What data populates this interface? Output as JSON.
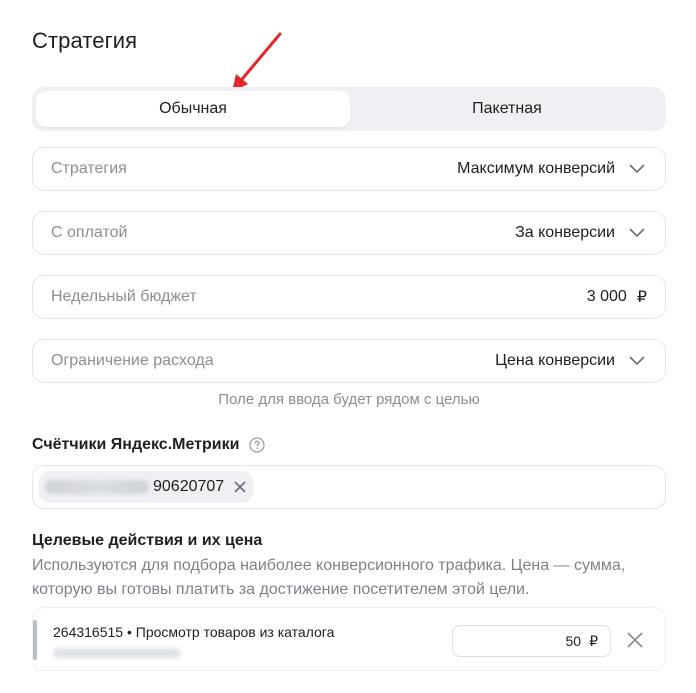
{
  "header": {
    "title": "Стратегия"
  },
  "strategy_type": {
    "options": [
      "Обычная",
      "Пакетная"
    ],
    "selected": "Обычная"
  },
  "fields": {
    "strategy": {
      "label": "Стратегия",
      "value": "Максимум конверсий"
    },
    "payment": {
      "label": "С оплатой",
      "value": "За конверсии"
    },
    "weekly_budget": {
      "label": "Недельный бюджет",
      "value": "3 000",
      "currency": "₽"
    },
    "spend_limit": {
      "label": "Ограничение расхода",
      "value": "Цена конверсии"
    }
  },
  "hint": "Поле для ввода будет рядом с целью",
  "counters": {
    "title": "Счётчики Яндекс.Метрики",
    "chip_id": "90620707"
  },
  "goals": {
    "title": "Целевые действия и их цена",
    "description": "Используются для подбора наиболее конверсионного трафика. Цена — сумма, которую вы готовы платить за достижение посетителем этой цели.",
    "items": [
      {
        "name": "264316515 • Просмотр товаров из каталога",
        "price": "50",
        "currency": "₽"
      }
    ]
  },
  "colors": {
    "accent_arrow": "#e3262b",
    "border": "#e3e5e8",
    "muted_text": "#8b8e94"
  },
  "icons": {
    "arrow": "red-arrow-icon",
    "chevron": "chevron-down-icon",
    "help": "question-circle-icon",
    "close": "close-icon"
  }
}
